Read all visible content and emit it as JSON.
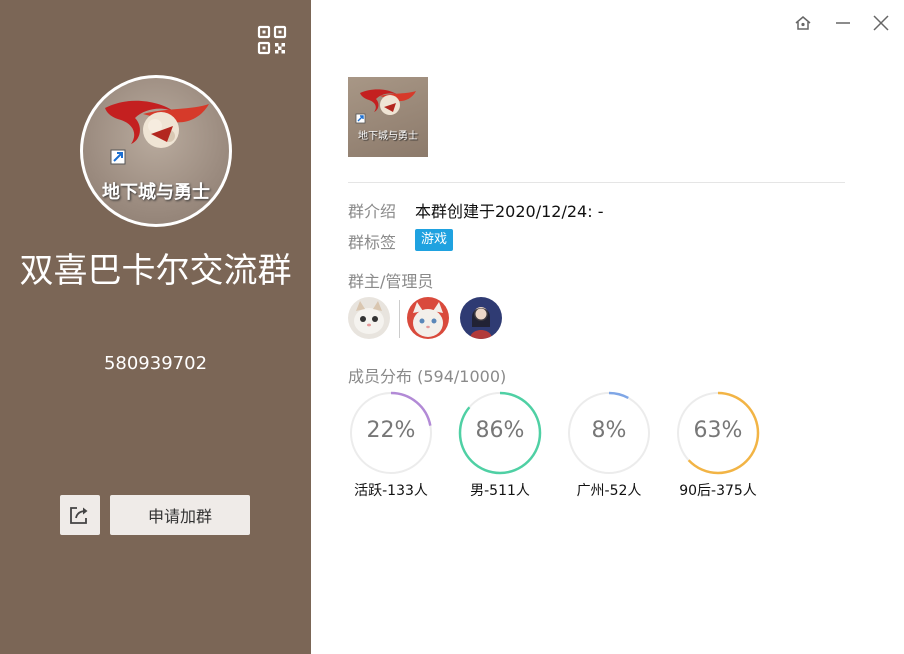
{
  "group": {
    "name": "双喜巴卡尔交流群",
    "id": "580939702",
    "avatar_caption": "地下城与勇士",
    "thumb_caption": "地下城与勇士"
  },
  "actions": {
    "join_label": "申请加群",
    "share_icon": "share-icon",
    "qr_icon": "qrcode-icon"
  },
  "window": {
    "controls": [
      "pin-icon",
      "minimize-icon",
      "close-icon"
    ]
  },
  "info": {
    "intro_label": "群介绍",
    "intro_value": "本群创建于2020/12/24:  -",
    "tag_label": "群标签",
    "tag_value": "游戏",
    "admins_label": "群主/管理员"
  },
  "members": {
    "label": "成员分布",
    "count": "(594/1000)",
    "stats": [
      {
        "pct_text": "22%",
        "pct": 22,
        "caption": "活跃-133人",
        "color": "#b28ad6"
      },
      {
        "pct_text": "86%",
        "pct": 86,
        "caption": "男-511人",
        "color": "#4fd0a4"
      },
      {
        "pct_text": "8%",
        "pct": 8,
        "caption": "广州-52人",
        "color": "#7fa6e6"
      },
      {
        "pct_text": "63%",
        "pct": 63,
        "caption": "90后-375人",
        "color": "#f2b445"
      }
    ]
  },
  "colors": {
    "panel_bg": "#7b6656",
    "tag_bg": "#1fa2e0"
  }
}
